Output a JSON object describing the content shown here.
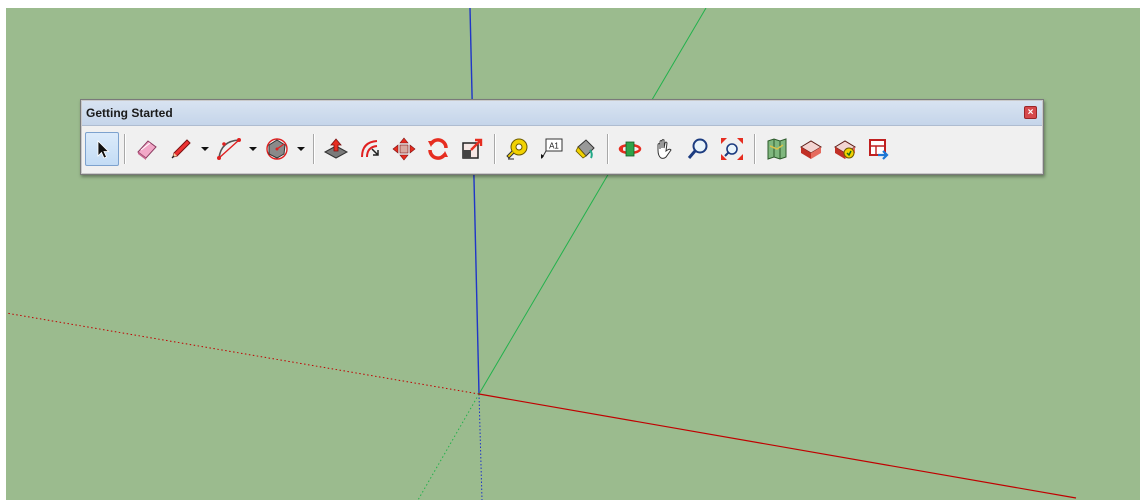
{
  "window": {
    "title": "Getting Started",
    "close_glyph": "×"
  },
  "colors": {
    "viewport_bg": "#9bbb8e",
    "red_axis": "#c00000",
    "green_axis": "#22b14c",
    "blue_axis": "#1f35c8",
    "titlebar": "#cdd9ec",
    "close": "#d6494c"
  },
  "toolbar": {
    "groups": [
      [
        {
          "name": "select-tool",
          "icon": "arrow-cursor-icon",
          "active": true
        }
      ],
      [
        {
          "name": "eraser-tool",
          "icon": "eraser-icon"
        },
        {
          "name": "line-tool",
          "icon": "pencil-icon",
          "dropdown": true
        },
        {
          "name": "arc-tool",
          "icon": "arc-icon",
          "dropdown": true
        },
        {
          "name": "shapes-tool",
          "icon": "polygon-icon",
          "dropdown": true
        }
      ],
      [
        {
          "name": "push-pull-tool",
          "icon": "push-pull-icon"
        },
        {
          "name": "offset-tool",
          "icon": "offset-icon"
        },
        {
          "name": "move-tool",
          "icon": "move-icon"
        },
        {
          "name": "rotate-tool",
          "icon": "rotate-icon"
        },
        {
          "name": "scale-tool",
          "icon": "scale-icon"
        }
      ],
      [
        {
          "name": "tape-measure-tool",
          "icon": "tape-measure-icon"
        },
        {
          "name": "text-tool",
          "icon": "text-label-icon",
          "label": "A1"
        },
        {
          "name": "paint-bucket-tool",
          "icon": "paint-bucket-icon"
        }
      ],
      [
        {
          "name": "orbit-tool",
          "icon": "orbit-icon"
        },
        {
          "name": "pan-tool",
          "icon": "hand-icon"
        },
        {
          "name": "zoom-tool",
          "icon": "magnifier-icon"
        },
        {
          "name": "zoom-extents-tool",
          "icon": "zoom-extents-icon"
        }
      ],
      [
        {
          "name": "add-location-button",
          "icon": "map-icon"
        },
        {
          "name": "3d-warehouse-button",
          "icon": "warehouse-icon"
        },
        {
          "name": "extension-warehouse-button",
          "icon": "extension-warehouse-icon"
        },
        {
          "name": "send-to-layout-button",
          "icon": "layout-icon"
        }
      ]
    ]
  }
}
